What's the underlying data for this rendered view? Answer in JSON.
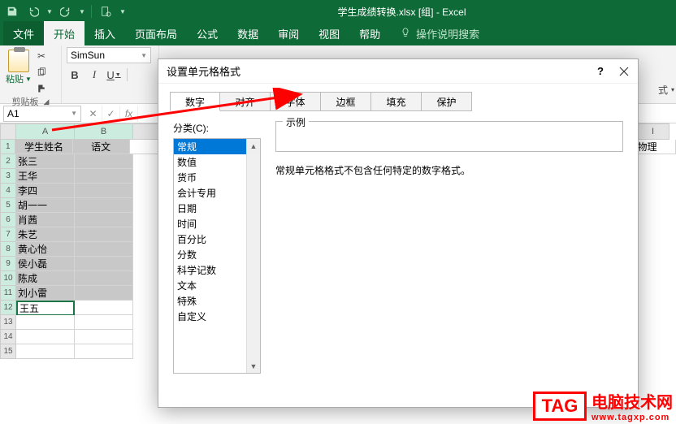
{
  "app": {
    "title": "学生成绩转换.xlsx [组] - Excel"
  },
  "qat": {
    "save": "save-icon",
    "undo": "undo-icon",
    "redo": "redo-icon",
    "preview": "print-preview-icon"
  },
  "ribbon": {
    "tabs": {
      "file": "文件",
      "home": "开始",
      "insert": "插入",
      "layout": "页面布局",
      "formula": "公式",
      "data": "数据",
      "review": "审阅",
      "view": "视图",
      "help": "帮助"
    },
    "search_placeholder": "操作说明搜索",
    "paste_label": "粘贴",
    "clipboard_label": "剪贴板",
    "font_name": "SimSun",
    "bold": "B",
    "italic": "I",
    "underline": "U",
    "style_dropdown": "式"
  },
  "namebox": "A1",
  "columns": [
    "A",
    "B",
    "I"
  ],
  "header_row": {
    "c0": "学生姓名",
    "c1": "语文",
    "cI": "物理"
  },
  "students": [
    "张三",
    "王华",
    "李四",
    "胡一一",
    "肖茜",
    "朱艺",
    "黄心怡",
    "侯小磊",
    "陈成",
    "刘小雷",
    "王五"
  ],
  "dialog": {
    "title": "设置单元格格式",
    "help": "?",
    "tabs": {
      "number": "数字",
      "align": "对齐",
      "font": "字体",
      "border": "边框",
      "fill": "填充",
      "protect": "保护"
    },
    "category_label": "分类(C):",
    "categories": [
      "常规",
      "数值",
      "货币",
      "会计专用",
      "日期",
      "时间",
      "百分比",
      "分数",
      "科学记数",
      "文本",
      "特殊",
      "自定义"
    ],
    "selected_category": "常规",
    "sample_label": "示例",
    "description": "常规单元格格式不包含任何特定的数字格式。"
  },
  "watermark": {
    "tag": "TAG",
    "text": "电脑技术网",
    "url": "www.tagxp.com"
  }
}
